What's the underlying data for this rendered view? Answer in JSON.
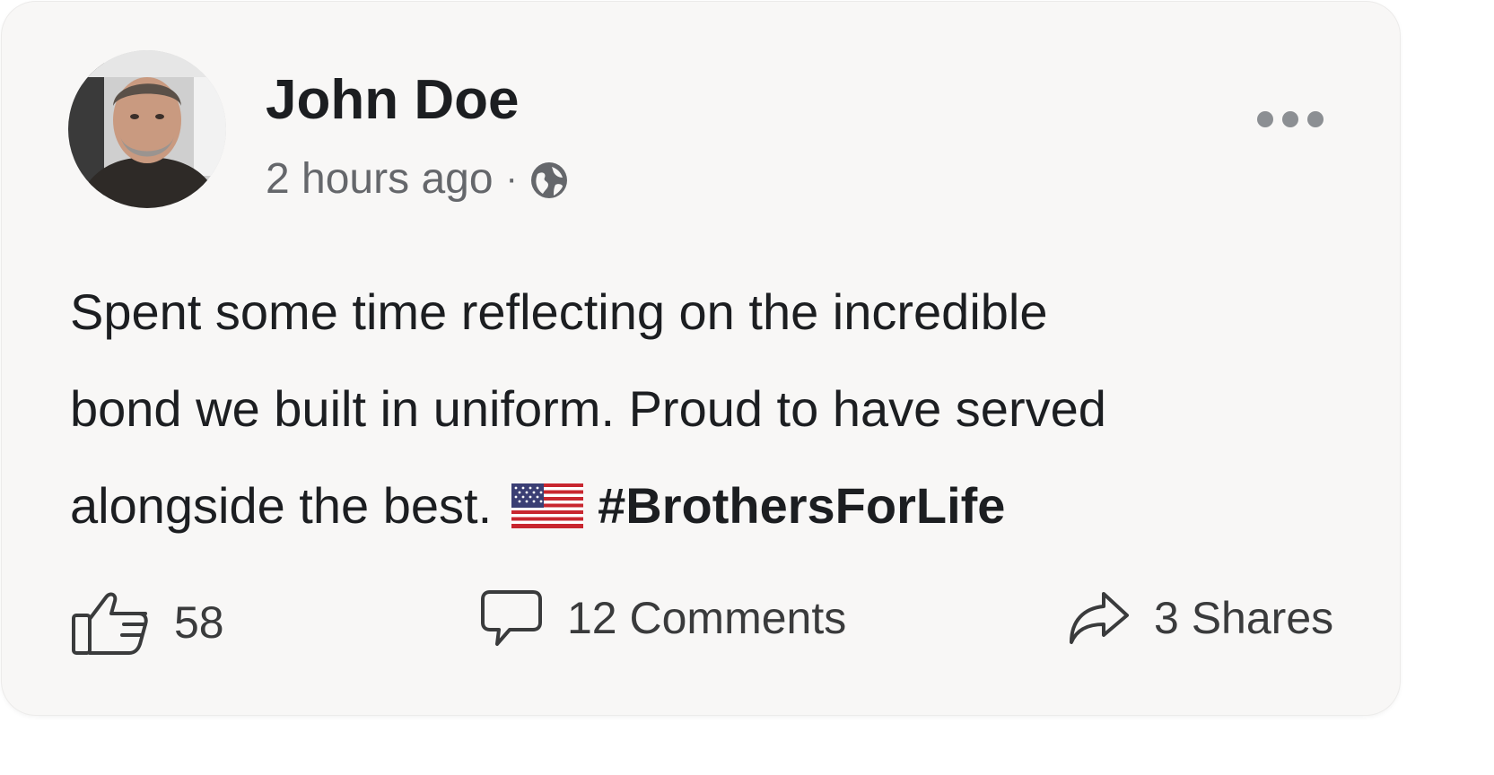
{
  "post": {
    "author": {
      "name": "John Doe",
      "avatar_icon": "avatar-photo"
    },
    "timestamp": "2 hours ago",
    "separator": "·",
    "privacy_icon": "globe-icon",
    "menu_icon": "more-options-icon",
    "content": {
      "lines": [
        "Spent some time reflecting on the incredible",
        "bond we built in uniform. Proud to have served",
        "alongside the best."
      ],
      "emoji": "us-flag-emoji",
      "hashtag": "#BrothersForLife"
    },
    "actions": {
      "likes": "58",
      "comments": "12 Comments",
      "shares": "3 Shares"
    }
  },
  "colors": {
    "card_background": "#f8f7f6",
    "primary_text": "#1c1e21",
    "secondary_text": "#65676b",
    "icon_stroke": "#3a3b3c"
  }
}
